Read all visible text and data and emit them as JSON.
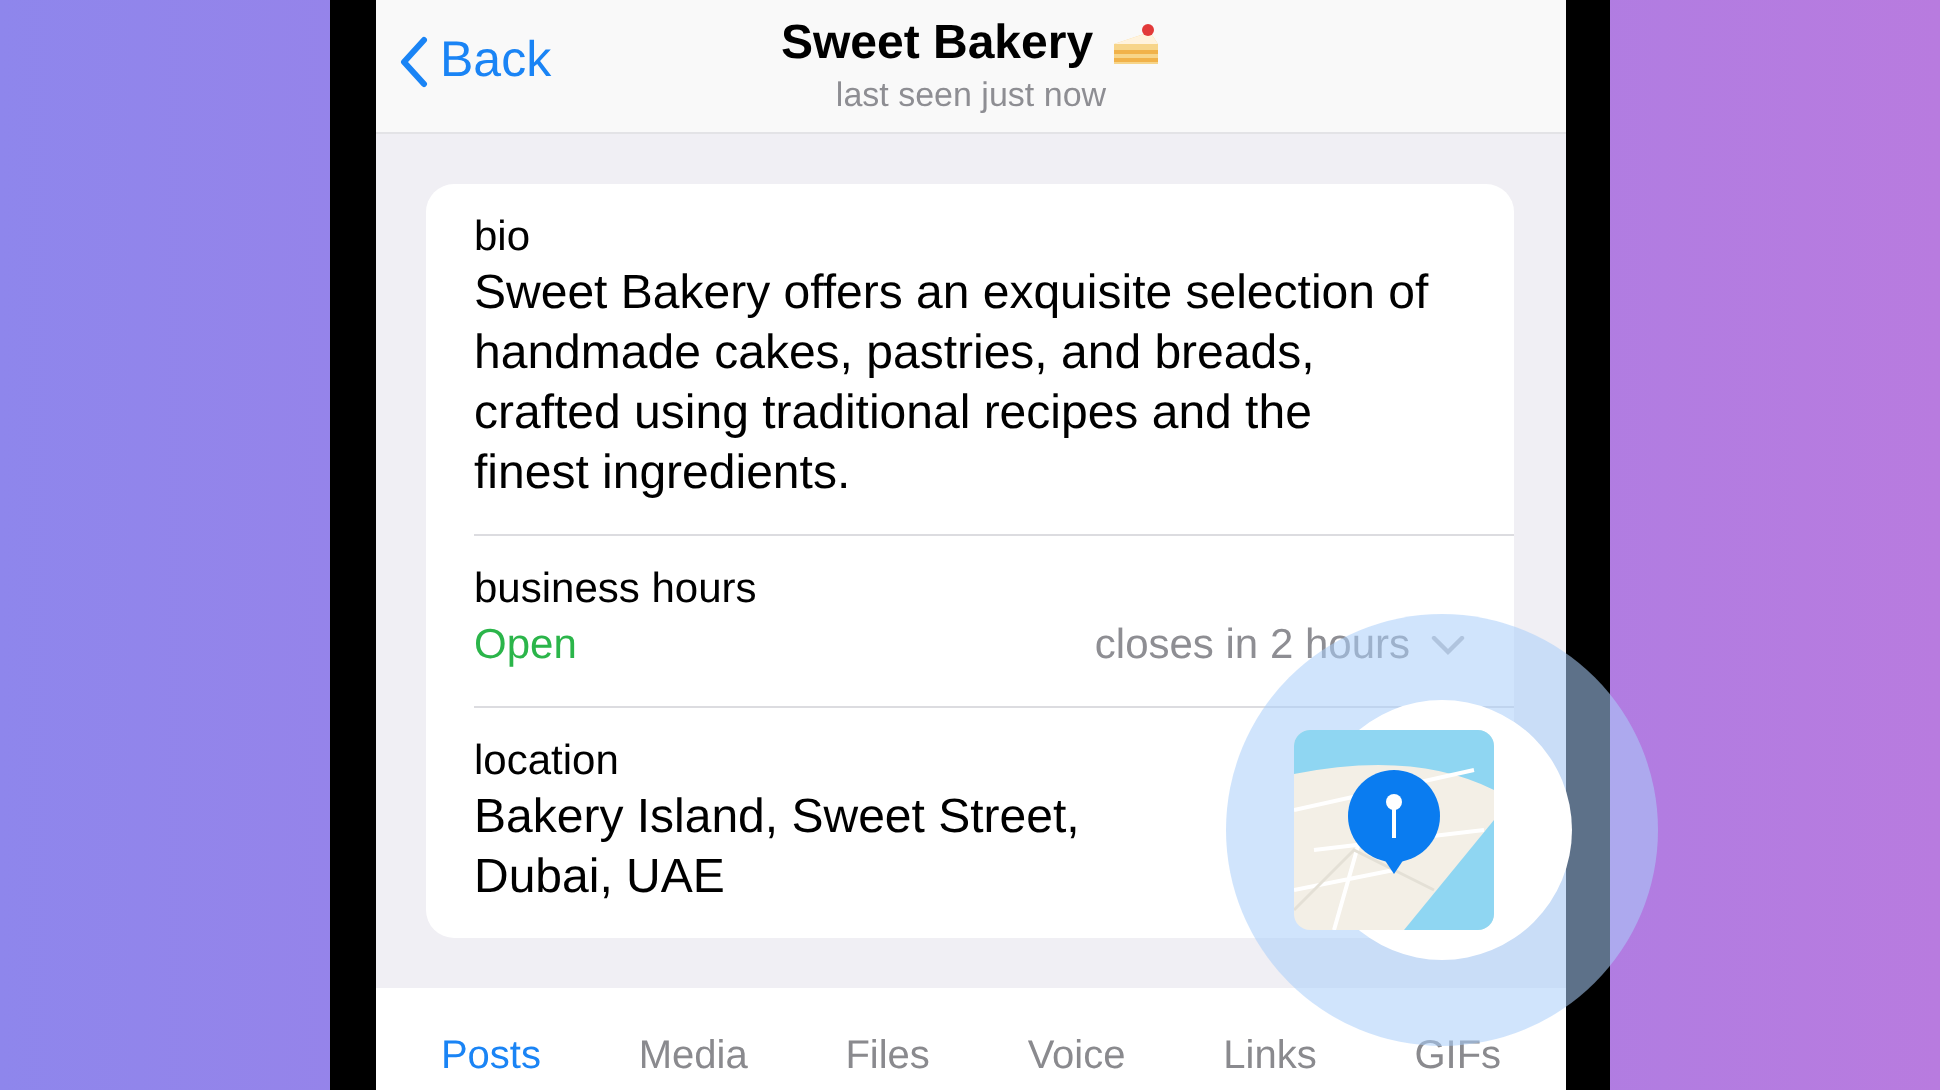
{
  "header": {
    "back": "Back",
    "title": "Sweet Bakery",
    "subtitle": "last seen just now"
  },
  "bio": {
    "label": "bio",
    "text": "Sweet Bakery offers an exquisite selection of handmade cakes, pastries, and breads, crafted using traditional recipes and the finest ingredients."
  },
  "business_hours": {
    "label": "business hours",
    "status": "Open",
    "open": true,
    "note": "closes in 2 hours",
    "expanded": false
  },
  "location": {
    "label": "location",
    "address": "Bakery Island, Sweet Street, Dubai, UAE",
    "highlighted": true
  },
  "tabs": [
    {
      "label": "Posts",
      "selected": true
    },
    {
      "label": "Media",
      "selected": false
    },
    {
      "label": "Files",
      "selected": false
    },
    {
      "label": "Voice",
      "selected": false
    },
    {
      "label": "Links",
      "selected": false
    },
    {
      "label": "GIFs",
      "selected": false
    }
  ]
}
